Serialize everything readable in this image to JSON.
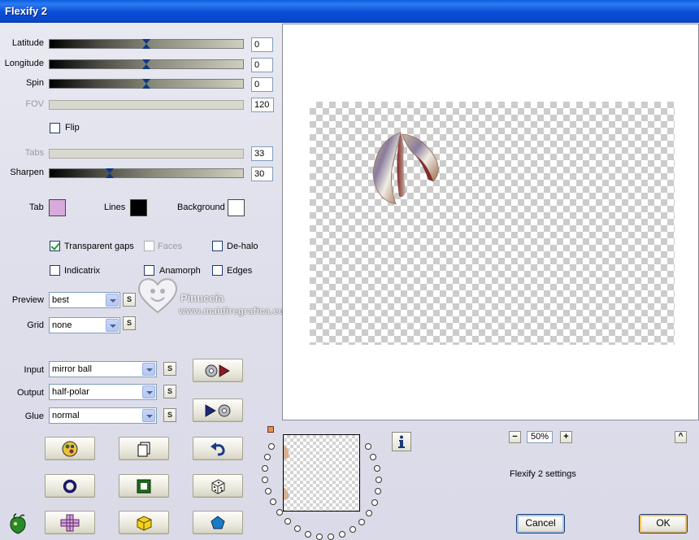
{
  "window": {
    "title": "Flexify 2"
  },
  "params": {
    "latitude": {
      "label": "Latitude",
      "value": "0",
      "position": 0.5
    },
    "longitude": {
      "label": "Longitude",
      "value": "0",
      "position": 0.5
    },
    "spin": {
      "label": "Spin",
      "value": "0",
      "position": 0.5
    },
    "fov": {
      "label": "FOV",
      "value": "120"
    },
    "flip": {
      "label": "Flip",
      "checked": false
    },
    "tabs": {
      "label": "Tabs",
      "value": "33"
    },
    "sharpen": {
      "label": "Sharpen",
      "value": "30",
      "position": 0.3
    }
  },
  "colors": {
    "tab": {
      "label": "Tab",
      "color": "#D9A9DC"
    },
    "lines": {
      "label": "Lines",
      "color": "#000000"
    },
    "background": {
      "label": "Background",
      "color": "#FFFFFF"
    }
  },
  "options": {
    "transparent_gaps": {
      "label": "Transparent gaps",
      "checked": true
    },
    "faces": {
      "label": "Faces",
      "checked": false
    },
    "de_halo": {
      "label": "De-halo",
      "checked": false
    },
    "indicatrix": {
      "label": "Indicatrix",
      "checked": false
    },
    "anamorph": {
      "label": "Anamorph",
      "checked": false
    },
    "edges": {
      "label": "Edges",
      "checked": false
    }
  },
  "dropdowns": {
    "preview": {
      "label": "Preview",
      "value": "best"
    },
    "grid": {
      "label": "Grid",
      "value": "none"
    },
    "input": {
      "label": "Input",
      "value": "mirror ball"
    },
    "output": {
      "label": "Output",
      "value": "half-polar"
    },
    "glue": {
      "label": "Glue",
      "value": "normal"
    }
  },
  "small_button_label": "S",
  "watermark": {
    "name": "Pinuccia",
    "url": "www.maidiregrafica.eu"
  },
  "zoom": {
    "minus": "−",
    "value": "50%",
    "plus": "+"
  },
  "collapse_label": "^",
  "status_text": "Flexify 2 settings",
  "buttons": {
    "cancel": "Cancel",
    "ok": "OK"
  },
  "accent_colors": {
    "title_bar": "#0A4FD8",
    "panel": "#E0E0EC",
    "default_button": "#F6C255"
  }
}
